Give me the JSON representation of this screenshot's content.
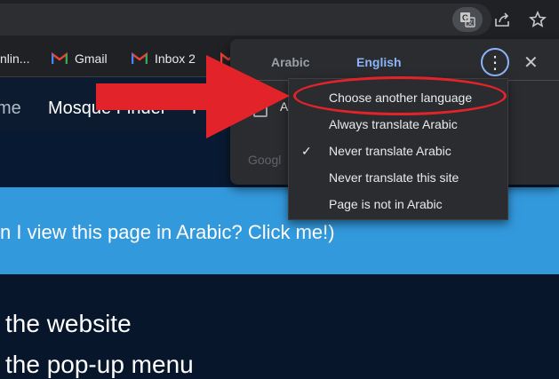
{
  "bookmarks": {
    "items": [
      {
        "label": "nlin..."
      },
      {
        "label": "Gmail"
      },
      {
        "label": "Inbox 2"
      }
    ]
  },
  "page": {
    "nav": {
      "left_fragment": "me",
      "mosque_finder": "Mosque Finder",
      "right_fragment": "F"
    },
    "banner_text": "n I view this page in Arabic? Click me!)",
    "lines": [
      " the website",
      " the pop-up menu"
    ]
  },
  "translate_popup": {
    "source_lang": "Arabic",
    "target_lang": "English",
    "kebab_glyph": "⋮",
    "close_glyph": "✕",
    "always_fragment": "A",
    "google_fragment": "Googl"
  },
  "menu": {
    "items": [
      {
        "label": "Choose another language",
        "checked": false
      },
      {
        "label": "Always translate Arabic",
        "checked": false
      },
      {
        "label": "Never translate Arabic",
        "checked": true
      },
      {
        "label": "Never translate this site",
        "checked": false
      },
      {
        "label": "Page is not in Arabic",
        "checked": false
      }
    ],
    "check_glyph": "✓"
  },
  "colors": {
    "annotation_red": "#e3232a",
    "accent_blue": "#8ab4f8",
    "banner_blue": "#3399dd"
  }
}
